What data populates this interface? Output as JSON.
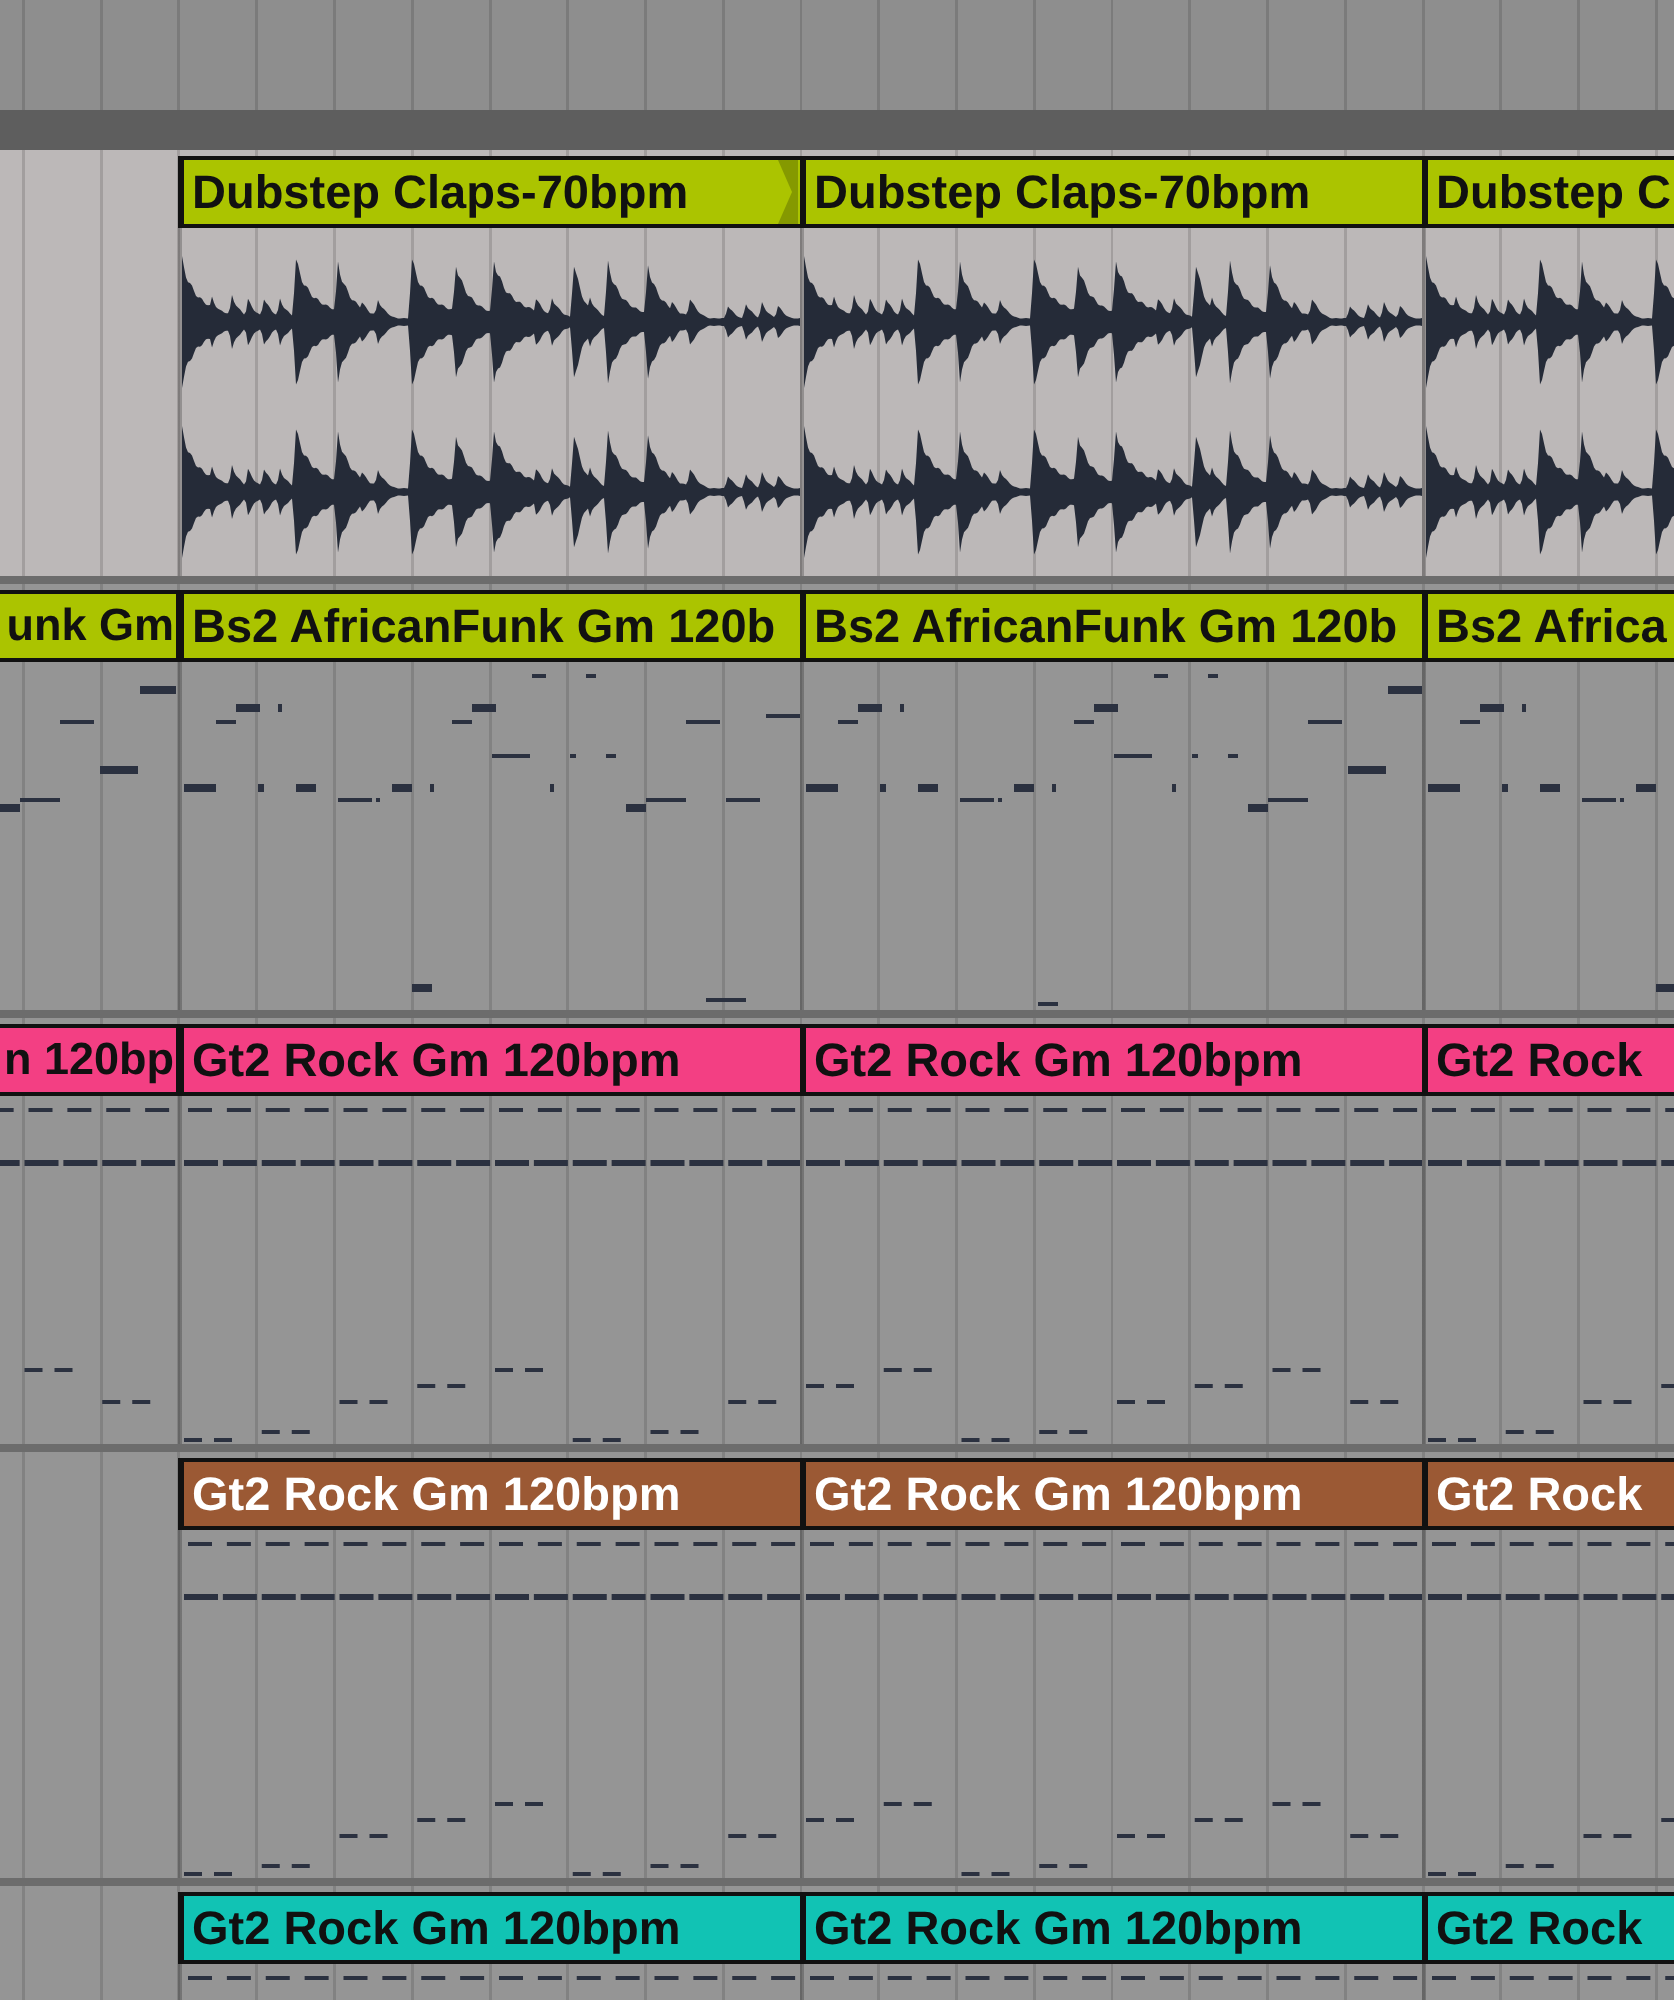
{
  "tracks": [
    {
      "kind": "audio",
      "color": "#abc400",
      "clips": [
        {
          "kind": "full",
          "name": "Dubstep Claps-70bpm",
          "end_marker": true
        },
        {
          "kind": "full",
          "name": "Dubstep Claps-70bpm",
          "end_marker": false
        },
        {
          "kind": "full",
          "name": "Dubstep C",
          "end_marker": false
        }
      ]
    },
    {
      "kind": "bassline",
      "color": "#abc400",
      "clips": [
        {
          "kind": "tail",
          "name": "unk Gm"
        },
        {
          "kind": "full",
          "name": "Bs2 AfricanFunk Gm 120b"
        },
        {
          "kind": "full",
          "name": "Bs2 AfricanFunk Gm 120b"
        },
        {
          "kind": "full",
          "name": "Bs2 Africa"
        }
      ]
    },
    {
      "kind": "riff",
      "color": "#f33f83",
      "clips": [
        {
          "kind": "tail",
          "name": "n 120bp"
        },
        {
          "kind": "full",
          "name": "Gt2 Rock Gm 120bpm"
        },
        {
          "kind": "full",
          "name": "Gt2 Rock Gm 120bpm"
        },
        {
          "kind": "full",
          "name": "Gt2 Rock"
        }
      ]
    },
    {
      "kind": "riff",
      "color": "#9b5934",
      "clips": [
        {
          "kind": "full",
          "name": "Gt2 Rock Gm 120bpm"
        },
        {
          "kind": "full",
          "name": "Gt2 Rock Gm 120bpm"
        },
        {
          "kind": "full",
          "name": "Gt2 Rock"
        }
      ]
    },
    {
      "kind": "riff",
      "color": "#11c3b4",
      "clips": [
        {
          "kind": "full",
          "name": "Gt2 Rock Gm 120bpm"
        },
        {
          "kind": "full",
          "name": "Gt2 Rock Gm 120bpm"
        },
        {
          "kind": "full",
          "name": "Gt2 Rock"
        }
      ]
    }
  ]
}
